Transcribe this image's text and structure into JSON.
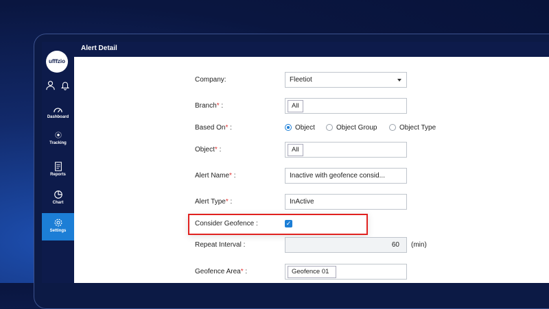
{
  "app": {
    "logo_text": "ufffzio",
    "title": "Alert Detail"
  },
  "sidebar": {
    "items": [
      {
        "label": "Dashboard",
        "icon": "gauge-icon"
      },
      {
        "label": "Tracking",
        "icon": "tracking-icon"
      },
      {
        "label": "Reports",
        "icon": "document-icon"
      },
      {
        "label": "Chart",
        "icon": "pie-chart-icon"
      },
      {
        "label": "Settings",
        "icon": "gear-icon",
        "active": true
      }
    ],
    "top_icons": [
      "user-icon",
      "bell-icon"
    ]
  },
  "form": {
    "company": {
      "label": "Company:",
      "value": "Fleetiot"
    },
    "branch": {
      "label": "Branch",
      "suffix": " :",
      "value": "All"
    },
    "based_on": {
      "label": "Based On",
      "suffix": " :",
      "options": [
        "Object",
        "Object Group",
        "Object Type"
      ],
      "selected": "Object"
    },
    "object": {
      "label": "Object",
      "suffix": " :",
      "value": "All"
    },
    "alert_name": {
      "label": "Alert Name",
      "suffix": " :",
      "value": "Inactive with geofence consid..."
    },
    "alert_type": {
      "label": "Alert Type",
      "suffix": " :",
      "value": "InActive"
    },
    "consider_geofence": {
      "label": "Consider Geofence :",
      "checked": true
    },
    "repeat_interval": {
      "label": "Repeat Interval :",
      "value": "60",
      "unit": "(min)"
    },
    "geofence_area": {
      "label": "Geofence Area",
      "suffix": " :",
      "value": "Geofence 01"
    },
    "required_mark": "*"
  },
  "colors": {
    "accent": "#1c7ed6",
    "highlight": "#e0211f",
    "sidebar_bg": "#0d1b4b"
  }
}
